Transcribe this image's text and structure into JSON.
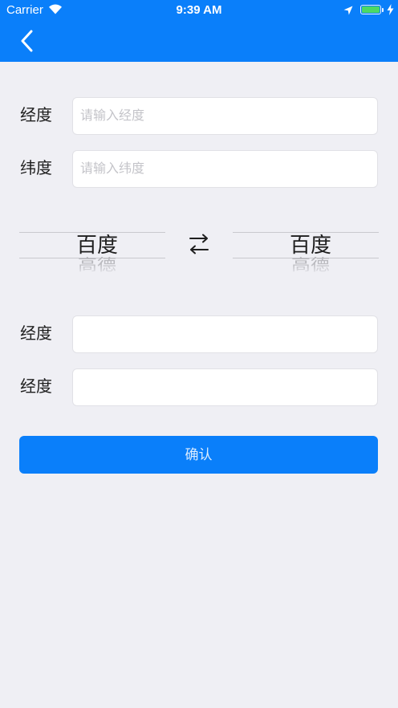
{
  "status_bar": {
    "carrier": "Carrier",
    "time": "9:39 AM",
    "icons": [
      "wifi-icon",
      "location-arrow-icon",
      "battery-icon",
      "charging-bolt-icon"
    ],
    "battery_level": 1.0
  },
  "nav_bar": {
    "back_icon": "chevron-left-icon"
  },
  "input_form": {
    "longitude": {
      "label": "经度",
      "placeholder": "请输入经度"
    },
    "latitude": {
      "label": "纬度",
      "placeholder": "请输入纬度"
    }
  },
  "pickers": {
    "source": {
      "selected": "百度",
      "next": "高德"
    },
    "swap_icon": "swap-arrows-icon",
    "target": {
      "selected": "百度",
      "next": "高德"
    }
  },
  "output_form": {
    "first": {
      "label": "经度",
      "value": ""
    },
    "second": {
      "label": "经度",
      "value": ""
    }
  },
  "confirm_button": {
    "label": "确认"
  },
  "colors": {
    "accent": "#0a7ffa",
    "background": "#efeff4",
    "battery": "#4cd964"
  }
}
